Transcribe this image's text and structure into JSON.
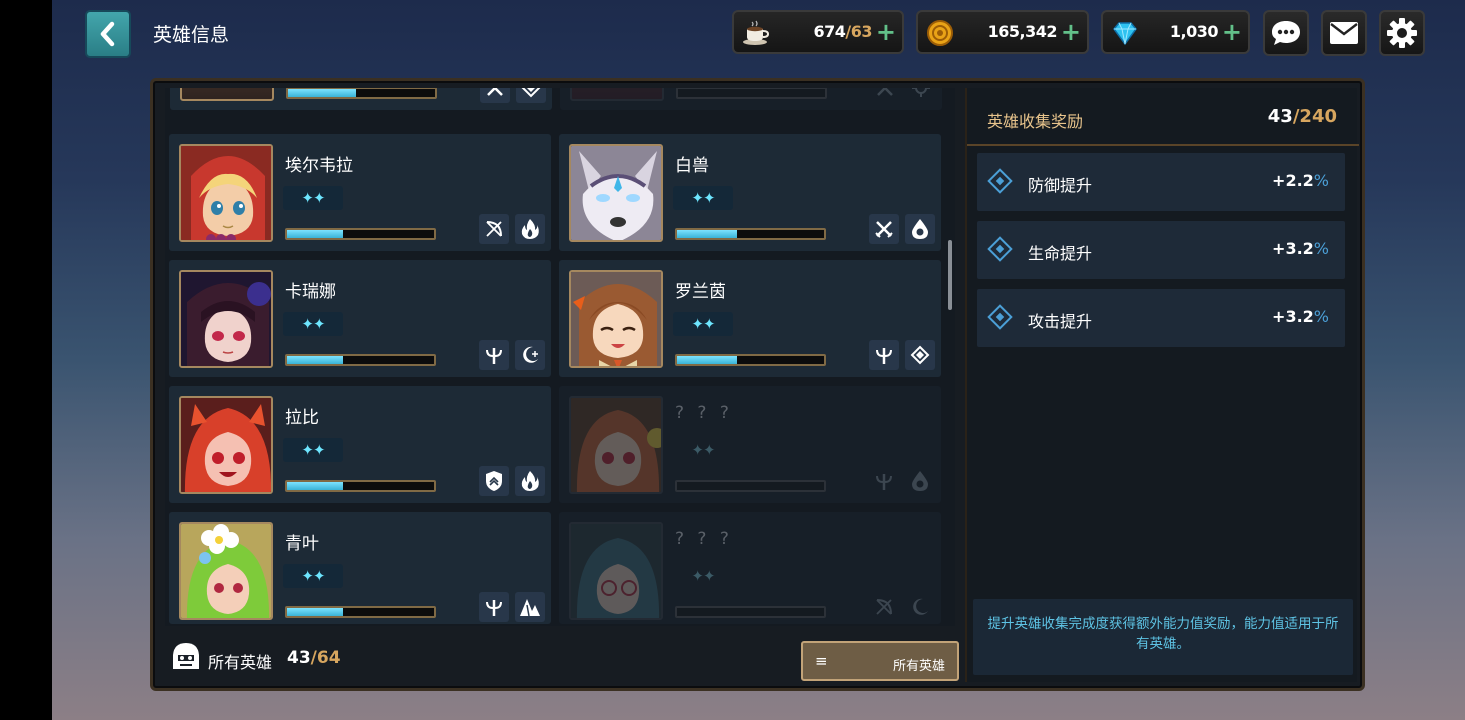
{
  "header": {
    "back_icon": "chevron-left-icon",
    "title": "英雄信息",
    "stamina": {
      "icon": "coffee-cup-icon",
      "current": "674",
      "max": "/63"
    },
    "gold": {
      "icon": "gold-coin-icon",
      "value": "165,342"
    },
    "gems": {
      "icon": "blue-gem-icon",
      "value": "1,030"
    },
    "plus_symbol": "+",
    "buttons": [
      "chat-icon",
      "mail-icon",
      "settings-icon"
    ]
  },
  "heroes": {
    "cards": [
      {
        "name": "",
        "locked": false,
        "progress": 0.46,
        "stars": "✦✦",
        "tags": [
          "crossed-swords-icon",
          "diamond-rune-icon"
        ]
      },
      {
        "name": "",
        "locked": true,
        "progress": 0,
        "stars": "",
        "tags": [
          "crossed-swords-icon",
          "sun-gear-icon"
        ]
      },
      {
        "name": "埃尔韦拉",
        "locked": false,
        "progress": 0.38,
        "stars": "✦✦",
        "tags": [
          "bow-icon",
          "fire-icon"
        ]
      },
      {
        "name": "白兽",
        "locked": false,
        "progress": 0.41,
        "stars": "✦✦",
        "tags": [
          "crossed-swords-icon",
          "water-drop-icon"
        ]
      },
      {
        "name": "卡瑞娜",
        "locked": false,
        "progress": 0.38,
        "stars": "✦✦",
        "tags": [
          "staff-icon",
          "moon-icon"
        ]
      },
      {
        "name": "罗兰茵",
        "locked": false,
        "progress": 0.41,
        "stars": "✦✦",
        "tags": [
          "staff-icon",
          "diamond-rune-icon"
        ]
      },
      {
        "name": "拉比",
        "locked": false,
        "progress": 0.38,
        "stars": "✦✦",
        "tags": [
          "shield-icon",
          "fire-icon"
        ]
      },
      {
        "name": "? ? ?",
        "locked": true,
        "progress": 0,
        "stars": "✦✦",
        "tags": [
          "staff-icon",
          "water-drop-icon"
        ]
      },
      {
        "name": "青叶",
        "locked": false,
        "progress": 0.38,
        "stars": "✦✦",
        "tags": [
          "staff-icon",
          "mountain-icon"
        ]
      },
      {
        "name": "? ? ?",
        "locked": true,
        "progress": 0,
        "stars": "✦✦",
        "tags": [
          "bow-icon",
          "moon-icon"
        ]
      }
    ]
  },
  "footer": {
    "icon": "hero-helmet-icon",
    "label": "所有英雄",
    "count": "43",
    "total": "/64",
    "filter_button": "所有英雄"
  },
  "bonus": {
    "title": "英雄收集奖励",
    "count": "43",
    "total": "/240",
    "rows": [
      {
        "label": "防御提升",
        "value": "+2.2",
        "unit": "%"
      },
      {
        "label": "生命提升",
        "value": "+3.2",
        "unit": "%"
      },
      {
        "label": "攻击提升",
        "value": "+3.2",
        "unit": "%"
      }
    ],
    "note": "提升英雄收集完成度获得额外能力值奖励，能力值适用于所有英雄。"
  },
  "colors": {
    "accent_gold": "#d7a65f",
    "accent_blue": "#4b9fd6",
    "bar_cyan": "#5ccff0"
  }
}
